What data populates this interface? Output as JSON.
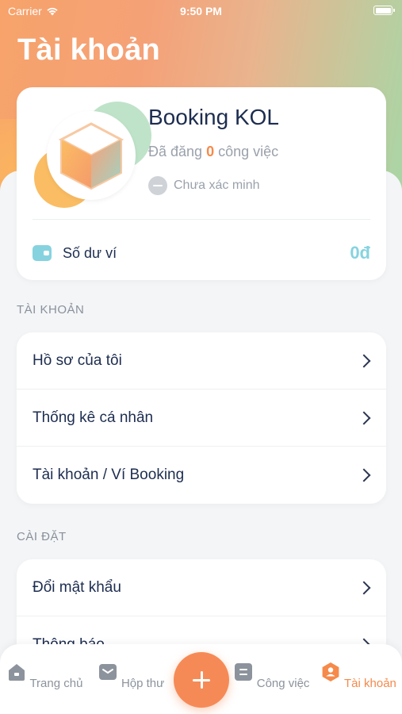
{
  "status_bar": {
    "carrier": "Carrier",
    "time": "9:50 PM"
  },
  "header": {
    "title": "Tài khoản"
  },
  "profile": {
    "name": "Booking KOL",
    "jobs_prefix": "Đã đăng",
    "jobs_count": "0",
    "jobs_suffix": "công việc",
    "verify_status": "Chưa xác minh",
    "wallet_label": "Số dư ví",
    "wallet_value": "0đ"
  },
  "section_account": {
    "title": "TÀI KHOẢN",
    "items": [
      {
        "label": "Hồ sơ của tôi"
      },
      {
        "label": "Thống kê cá nhân"
      },
      {
        "label": "Tài khoản / Ví Booking"
      }
    ]
  },
  "section_settings": {
    "title": "CÀI ĐẶT",
    "items": [
      {
        "label": "Đổi mật khẩu"
      },
      {
        "label": "Thông báo"
      }
    ]
  },
  "tabbar": {
    "tabs": [
      {
        "label": "Trang chủ",
        "icon": "home-icon"
      },
      {
        "label": "Hộp thư",
        "icon": "mail-icon"
      },
      {
        "label": "Công việc",
        "icon": "list-icon"
      },
      {
        "label": "Tài khoản",
        "icon": "user-icon"
      }
    ],
    "active_color": "#f58a4b",
    "fab_icon": "plus-icon"
  },
  "colors": {
    "accent": "#f58a4b",
    "wallet": "#86d3df",
    "text": "#1d2d50"
  }
}
